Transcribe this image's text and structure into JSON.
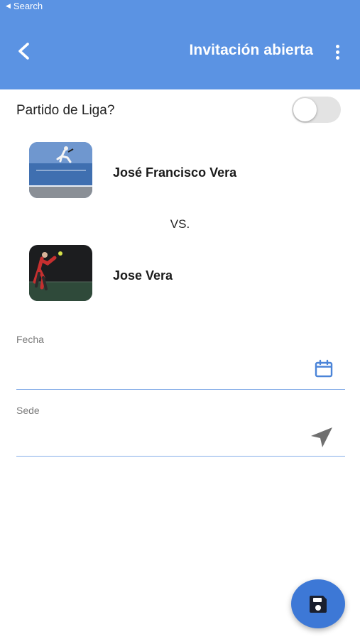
{
  "status_bar": {
    "back_label": "Search"
  },
  "header": {
    "title": "Invitación abierta"
  },
  "league": {
    "label": "Partido de Liga?",
    "enabled": false
  },
  "players": [
    {
      "name": "José Francisco Vera"
    },
    {
      "name": "Jose Vera"
    }
  ],
  "versus": "VS.",
  "form": {
    "date": {
      "label": "Fecha",
      "value": ""
    },
    "venue": {
      "label": "Sede",
      "value": ""
    }
  },
  "icons": {
    "back": "chevron-left-icon",
    "more": "more-vertical-icon",
    "date": "calendar-icon",
    "venue": "navigation-arrow-icon",
    "save": "floppy-disk-icon"
  },
  "colors": {
    "header": "#5b93e3",
    "accent": "#3d78d6",
    "field_line": "#86aee8"
  }
}
